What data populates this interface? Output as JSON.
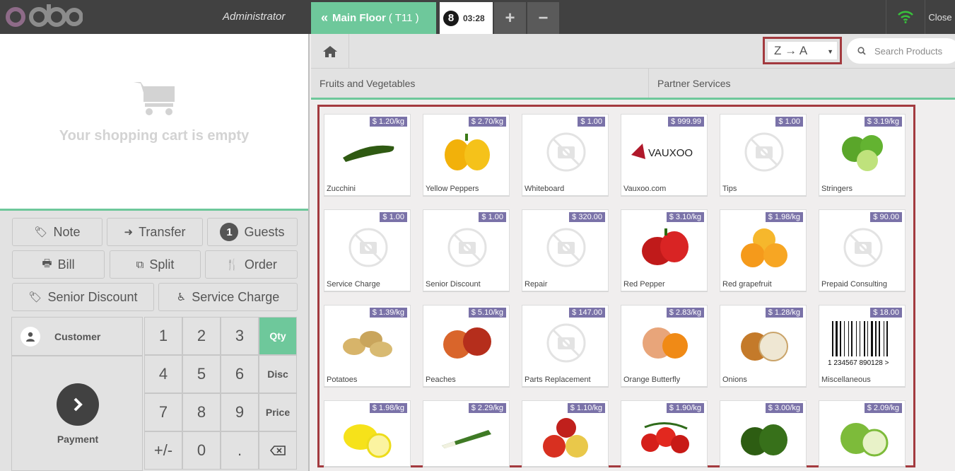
{
  "header": {
    "user": "Administrator",
    "order_tab": {
      "label": "Main Floor",
      "table": "( T11 )"
    },
    "ticket": {
      "number": "8",
      "time": "03:28"
    },
    "add_label": "+",
    "remove_label": "−",
    "close_label": "Close"
  },
  "cart": {
    "empty_text": "Your shopping cart is empty"
  },
  "control_buttons": {
    "note": "Note",
    "transfer": "Transfer",
    "guests_count": "1",
    "guests": "Guests",
    "bill": "Bill",
    "split": "Split",
    "order": "Order",
    "senior_discount": "Senior Discount",
    "service_charge": "Service Charge"
  },
  "numpad": {
    "customer": "Customer",
    "payment": "Payment",
    "keys": [
      "1",
      "2",
      "3",
      "4",
      "5",
      "6",
      "7",
      "8",
      "9",
      "+/-",
      "0",
      "."
    ],
    "modes": {
      "qty": "Qty",
      "disc": "Disc",
      "price": "Price"
    },
    "active_mode": "Qty"
  },
  "toolbar": {
    "sort_value": "Z → A",
    "search_placeholder": "Search Products"
  },
  "categories": [
    "Fruits and Vegetables",
    "Partner Services"
  ],
  "products": [
    {
      "name": "Zucchini",
      "price": "$ 1.20/kg",
      "icon": "zucchini"
    },
    {
      "name": "Yellow Peppers",
      "price": "$ 2.70/kg",
      "icon": "yellow-pepper"
    },
    {
      "name": "Whiteboard",
      "price": "$ 1.00",
      "icon": "placeholder"
    },
    {
      "name": "Vauxoo.com",
      "price": "$ 999.99",
      "icon": "vauxoo-logo"
    },
    {
      "name": "Tips",
      "price": "$ 1.00",
      "icon": "placeholder"
    },
    {
      "name": "Stringers",
      "price": "$ 3.19/kg",
      "icon": "limes"
    },
    {
      "name": "Service Charge",
      "price": "$ 1.00",
      "icon": "placeholder"
    },
    {
      "name": "Senior Discount",
      "price": "$ 1.00",
      "icon": "placeholder"
    },
    {
      "name": "Repair",
      "price": "$ 320.00",
      "icon": "placeholder"
    },
    {
      "name": "Red Pepper",
      "price": "$ 3.10/kg",
      "icon": "red-pepper"
    },
    {
      "name": "Red grapefruit",
      "price": "$ 1.98/kg",
      "icon": "grapefruit"
    },
    {
      "name": "Prepaid Consulting",
      "price": "$ 90.00",
      "icon": "placeholder"
    },
    {
      "name": "Potatoes",
      "price": "$ 1.39/kg",
      "icon": "potatoes"
    },
    {
      "name": "Peaches",
      "price": "$ 5.10/kg",
      "icon": "peaches"
    },
    {
      "name": "Parts Replacement",
      "price": "$ 147.00",
      "icon": "placeholder"
    },
    {
      "name": "Orange Butterfly",
      "price": "$ 2.83/kg",
      "icon": "orange"
    },
    {
      "name": "Onions",
      "price": "$ 1.28/kg",
      "icon": "onions"
    },
    {
      "name": "Miscellaneous",
      "price": "$ 18.00",
      "icon": "barcode",
      "barcode_text": "1 234567 890128 >"
    },
    {
      "name": "",
      "price": "$ 1.98/kg",
      "icon": "lemons"
    },
    {
      "name": "",
      "price": "$ 2.29/kg",
      "icon": "leeks"
    },
    {
      "name": "",
      "price": "$ 1.10/kg",
      "icon": "apples-red"
    },
    {
      "name": "",
      "price": "$ 1.90/kg",
      "icon": "tomatoes"
    },
    {
      "name": "",
      "price": "$ 3.00/kg",
      "icon": "green-pepper"
    },
    {
      "name": "",
      "price": "$ 2.09/kg",
      "icon": "apples-green"
    }
  ],
  "colors": {
    "header_bg": "#414141",
    "accent_green": "#6ec89b",
    "price_tag": "#7a72a8",
    "highlight_frame": "#a33a3f"
  }
}
